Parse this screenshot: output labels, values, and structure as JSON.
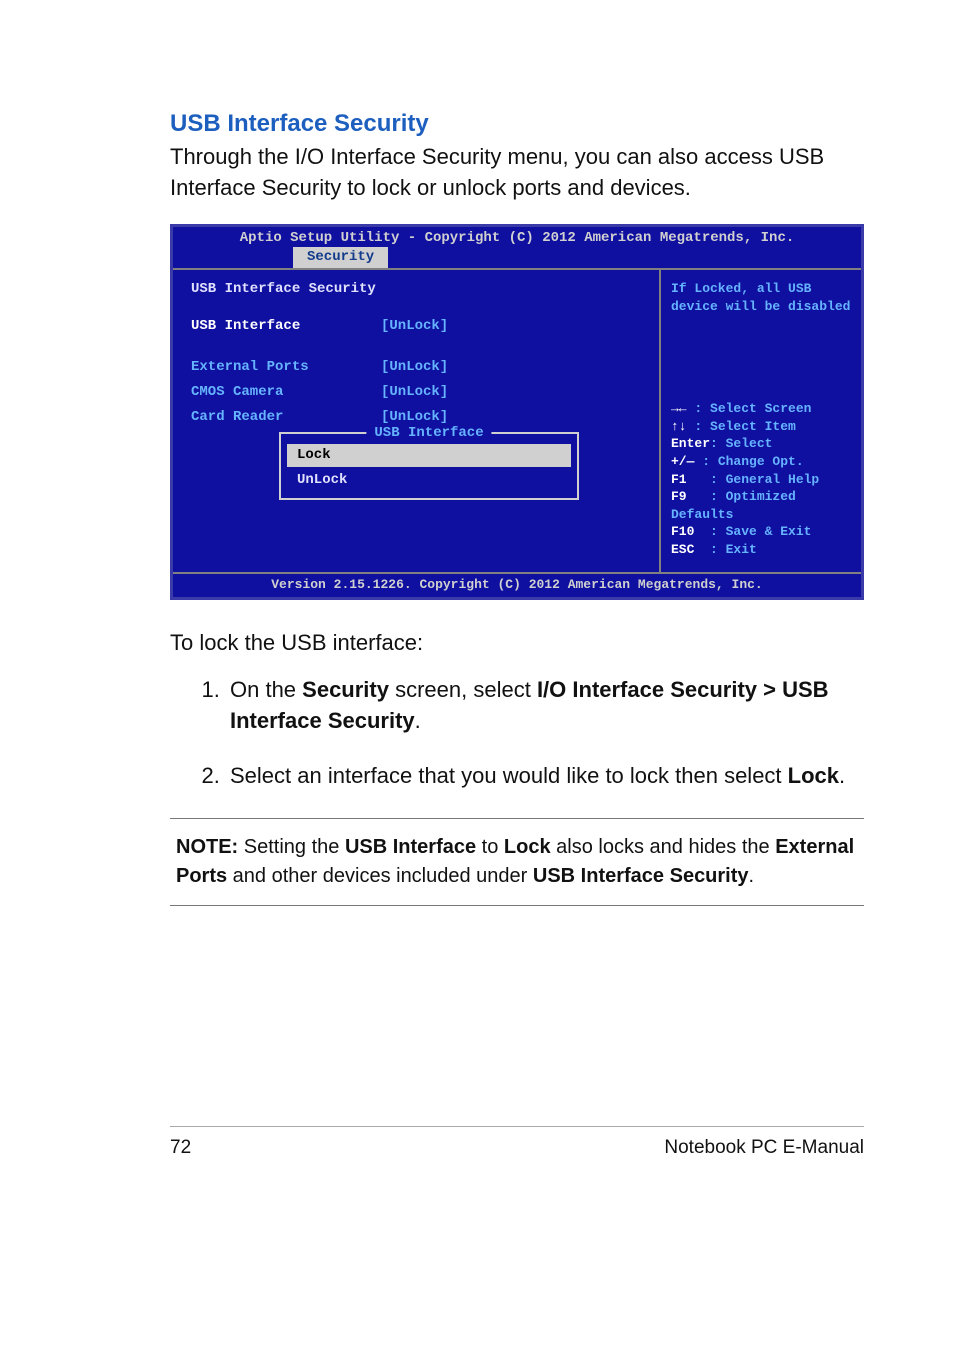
{
  "section_heading": "USB Interface Security",
  "intro": "Through the I/O Interface Security menu, you can also access USB Interface Security to lock or unlock ports and devices.",
  "bios": {
    "header": "Aptio Setup Utility - Copyright (C) 2012 American Megatrends, Inc.",
    "tab": "Security",
    "title": "USB Interface Security",
    "rows": [
      {
        "label": "USB Interface",
        "value": "[UnLock]",
        "selected": true
      },
      {
        "label": "External Ports",
        "value": "[UnLock]"
      },
      {
        "label": "CMOS Camera",
        "value": "[UnLock]"
      },
      {
        "label": "Card Reader",
        "value": "[UnLock]"
      }
    ],
    "popup": {
      "title": "USB Interface",
      "items": [
        "Lock",
        "UnLock"
      ],
      "selected": "Lock"
    },
    "help_text": "If Locked, all USB device will be disabled",
    "keys": [
      {
        "k": "→←",
        "d": ": Select Screen"
      },
      {
        "k": "↑↓",
        "d": ": Select Item"
      },
      {
        "k": "Enter",
        "d": ": Select",
        "inline": true
      },
      {
        "k": "+/—",
        "d": ": Change Opt."
      },
      {
        "k": "F1",
        "d": ": General Help"
      },
      {
        "k": "F9",
        "d": ": Optimized Defaults",
        "wrap": true
      },
      {
        "k": "F10",
        "d": ": Save & Exit"
      },
      {
        "k": "ESC",
        "d": ": Exit"
      }
    ],
    "footer": "Version 2.15.1226. Copyright (C) 2012 American Megatrends, Inc."
  },
  "lock_intro": "To lock the USB interface:",
  "steps": {
    "s1_pre": "On the ",
    "s1_b1": "Security",
    "s1_mid": " screen, select ",
    "s1_b2": "I/O Interface Security > USB Interface Security",
    "s1_post": ".",
    "s2_pre": "Select an interface that you would like to lock then select ",
    "s2_b1": "Lock",
    "s2_post": "."
  },
  "note": {
    "n_b1": "NOTE:",
    "n_t1": " Setting the ",
    "n_b2": "USB Interface",
    "n_t2": " to ",
    "n_b3": "Lock",
    "n_t3": " also locks and hides the ",
    "n_b4": "External Ports",
    "n_t4": " and other devices included under ",
    "n_b5": "USB Interface Security",
    "n_t5": "."
  },
  "footer": {
    "page": "72",
    "title": "Notebook PC E-Manual"
  }
}
